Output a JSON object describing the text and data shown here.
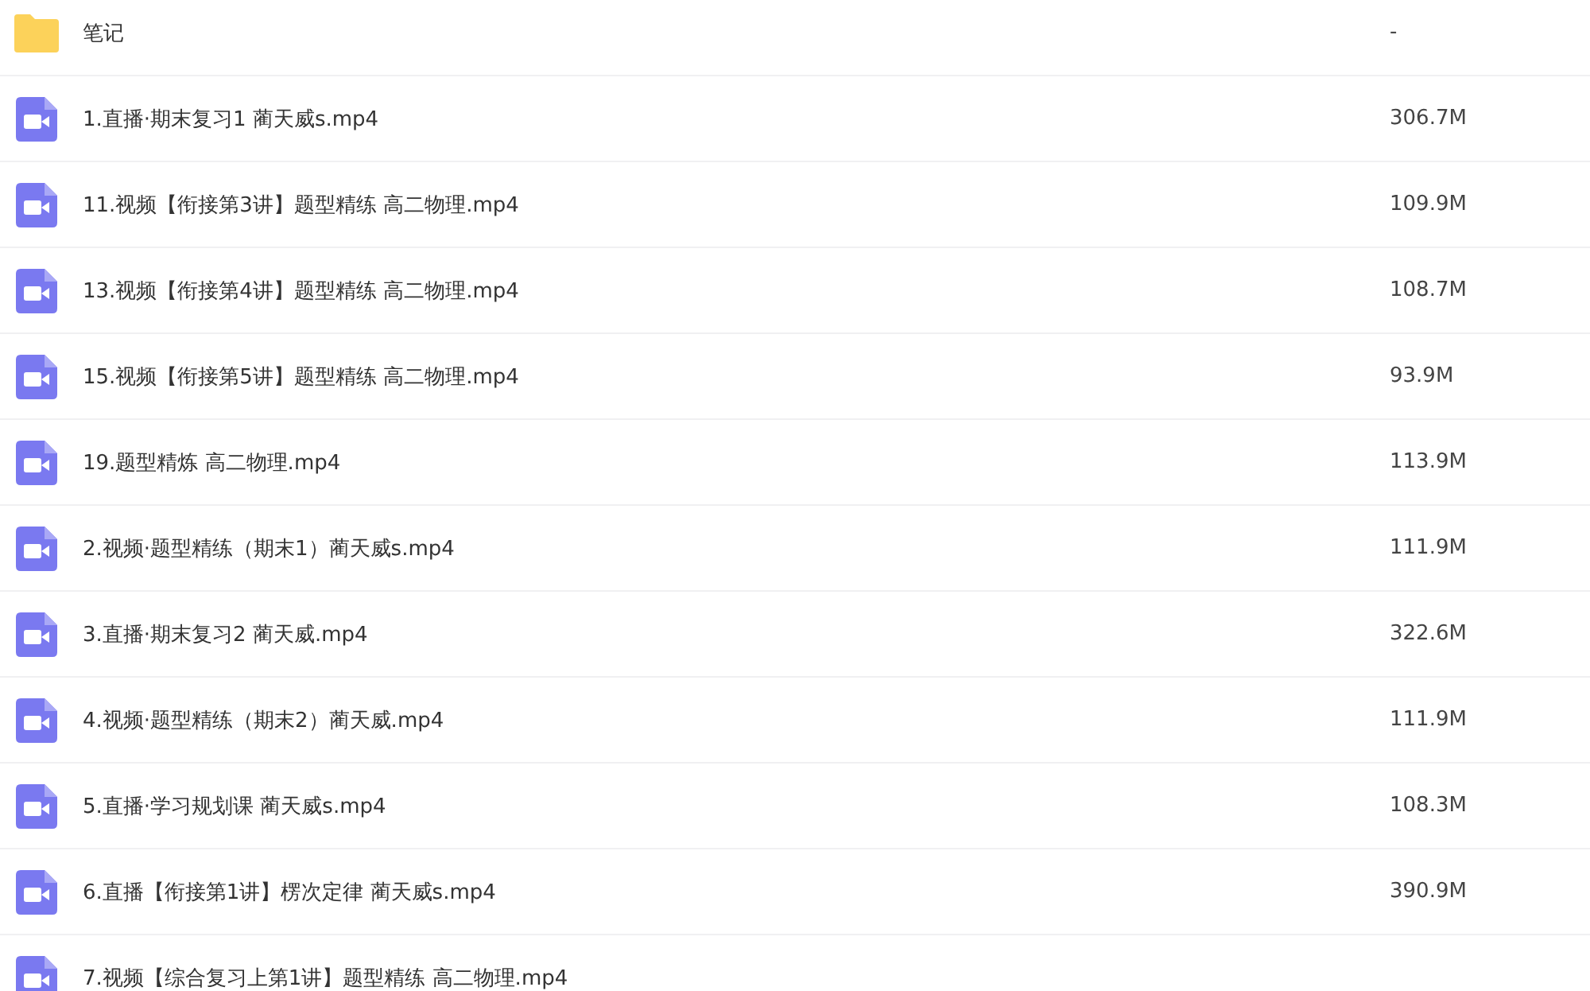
{
  "files": [
    {
      "kind": "folder",
      "name": "笔记",
      "size": "-"
    },
    {
      "kind": "video",
      "name": "1.直播·期末复习1 蔺天威s.mp4",
      "size": "306.7M"
    },
    {
      "kind": "video",
      "name": "11.视频【衔接第3讲】题型精练 高二物理.mp4",
      "size": "109.9M"
    },
    {
      "kind": "video",
      "name": "13.视频【衔接第4讲】题型精练 高二物理.mp4",
      "size": "108.7M"
    },
    {
      "kind": "video",
      "name": "15.视频【衔接第5讲】题型精练 高二物理.mp4",
      "size": "93.9M"
    },
    {
      "kind": "video",
      "name": "19.题型精炼 高二物理.mp4",
      "size": "113.9M"
    },
    {
      "kind": "video",
      "name": "2.视频·题型精练（期末1）蔺天威s.mp4",
      "size": "111.9M"
    },
    {
      "kind": "video",
      "name": "3.直播·期末复习2 蔺天威.mp4",
      "size": "322.6M"
    },
    {
      "kind": "video",
      "name": "4.视频·题型精练（期末2）蔺天威.mp4",
      "size": "111.9M"
    },
    {
      "kind": "video",
      "name": "5.直播·学习规划课 蔺天威s.mp4",
      "size": "108.3M"
    },
    {
      "kind": "video",
      "name": "6.直播【衔接第1讲】楞次定律 蔺天威s.mp4",
      "size": "390.9M"
    },
    {
      "kind": "video",
      "name": "7.视频【综合复习上第1讲】题型精练 高二物理.mp4"
    }
  ]
}
